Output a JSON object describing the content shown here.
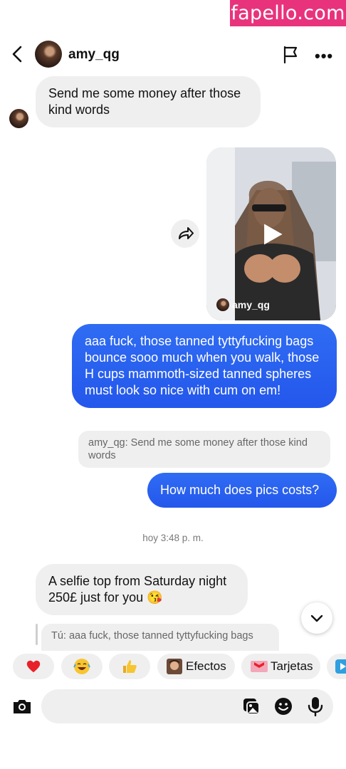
{
  "watermark": "fapello.com",
  "header": {
    "username": "amy_qg"
  },
  "messages": {
    "m1": "Send me some money after those kind words",
    "video_username": "amy_qg",
    "m2": "aaa fuck, those tanned tyttyfucking bags bounce sooo much when you walk, those H cups mammoth-sized tanned spheres must look so nice with cum on em!",
    "reply_quote": "amy_qg: Send me some money after those kind words",
    "m3": "How much does pics costs?",
    "timestamp": "hoy 3:48 p. m.",
    "m4": "A selfie top from Saturday night 250£ just for you 😘",
    "reply_quote2": "Tú: aaa fuck, those tanned tyttyfucking bags"
  },
  "quick_replies": [
    {
      "icon": "heart-emoji",
      "label": ""
    },
    {
      "icon": "laugh-emoji",
      "label": ""
    },
    {
      "icon": "thumbs-up-emoji",
      "label": ""
    },
    {
      "icon": "effects-icon",
      "label": "Efectos"
    },
    {
      "icon": "cards-icon",
      "label": "Tarjetas"
    }
  ],
  "colors": {
    "outgoing_bubble": "#2f6cf3",
    "incoming_bubble": "#efefef",
    "watermark": "#e8337c"
  }
}
